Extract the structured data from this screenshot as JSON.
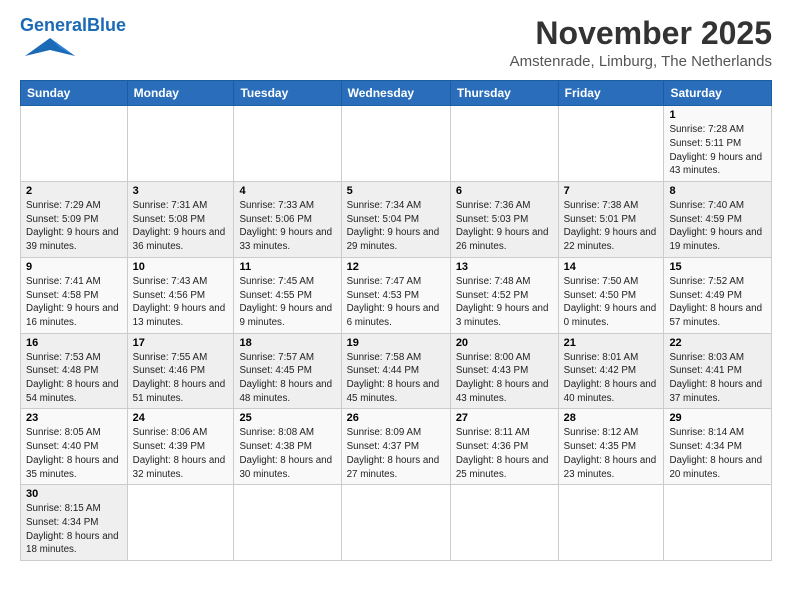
{
  "header": {
    "logo_general": "General",
    "logo_blue": "Blue",
    "title": "November 2025",
    "subtitle": "Amstenrade, Limburg, The Netherlands"
  },
  "days_of_week": [
    "Sunday",
    "Monday",
    "Tuesday",
    "Wednesday",
    "Thursday",
    "Friday",
    "Saturday"
  ],
  "weeks": [
    [
      {
        "day": "",
        "info": ""
      },
      {
        "day": "",
        "info": ""
      },
      {
        "day": "",
        "info": ""
      },
      {
        "day": "",
        "info": ""
      },
      {
        "day": "",
        "info": ""
      },
      {
        "day": "",
        "info": ""
      },
      {
        "day": "1",
        "info": "Sunrise: 7:28 AM\nSunset: 5:11 PM\nDaylight: 9 hours and 43 minutes."
      }
    ],
    [
      {
        "day": "2",
        "info": "Sunrise: 7:29 AM\nSunset: 5:09 PM\nDaylight: 9 hours and 39 minutes."
      },
      {
        "day": "3",
        "info": "Sunrise: 7:31 AM\nSunset: 5:08 PM\nDaylight: 9 hours and 36 minutes."
      },
      {
        "day": "4",
        "info": "Sunrise: 7:33 AM\nSunset: 5:06 PM\nDaylight: 9 hours and 33 minutes."
      },
      {
        "day": "5",
        "info": "Sunrise: 7:34 AM\nSunset: 5:04 PM\nDaylight: 9 hours and 29 minutes."
      },
      {
        "day": "6",
        "info": "Sunrise: 7:36 AM\nSunset: 5:03 PM\nDaylight: 9 hours and 26 minutes."
      },
      {
        "day": "7",
        "info": "Sunrise: 7:38 AM\nSunset: 5:01 PM\nDaylight: 9 hours and 22 minutes."
      },
      {
        "day": "8",
        "info": "Sunrise: 7:40 AM\nSunset: 4:59 PM\nDaylight: 9 hours and 19 minutes."
      }
    ],
    [
      {
        "day": "9",
        "info": "Sunrise: 7:41 AM\nSunset: 4:58 PM\nDaylight: 9 hours and 16 minutes."
      },
      {
        "day": "10",
        "info": "Sunrise: 7:43 AM\nSunset: 4:56 PM\nDaylight: 9 hours and 13 minutes."
      },
      {
        "day": "11",
        "info": "Sunrise: 7:45 AM\nSunset: 4:55 PM\nDaylight: 9 hours and 9 minutes."
      },
      {
        "day": "12",
        "info": "Sunrise: 7:47 AM\nSunset: 4:53 PM\nDaylight: 9 hours and 6 minutes."
      },
      {
        "day": "13",
        "info": "Sunrise: 7:48 AM\nSunset: 4:52 PM\nDaylight: 9 hours and 3 minutes."
      },
      {
        "day": "14",
        "info": "Sunrise: 7:50 AM\nSunset: 4:50 PM\nDaylight: 9 hours and 0 minutes."
      },
      {
        "day": "15",
        "info": "Sunrise: 7:52 AM\nSunset: 4:49 PM\nDaylight: 8 hours and 57 minutes."
      }
    ],
    [
      {
        "day": "16",
        "info": "Sunrise: 7:53 AM\nSunset: 4:48 PM\nDaylight: 8 hours and 54 minutes."
      },
      {
        "day": "17",
        "info": "Sunrise: 7:55 AM\nSunset: 4:46 PM\nDaylight: 8 hours and 51 minutes."
      },
      {
        "day": "18",
        "info": "Sunrise: 7:57 AM\nSunset: 4:45 PM\nDaylight: 8 hours and 48 minutes."
      },
      {
        "day": "19",
        "info": "Sunrise: 7:58 AM\nSunset: 4:44 PM\nDaylight: 8 hours and 45 minutes."
      },
      {
        "day": "20",
        "info": "Sunrise: 8:00 AM\nSunset: 4:43 PM\nDaylight: 8 hours and 43 minutes."
      },
      {
        "day": "21",
        "info": "Sunrise: 8:01 AM\nSunset: 4:42 PM\nDaylight: 8 hours and 40 minutes."
      },
      {
        "day": "22",
        "info": "Sunrise: 8:03 AM\nSunset: 4:41 PM\nDaylight: 8 hours and 37 minutes."
      }
    ],
    [
      {
        "day": "23",
        "info": "Sunrise: 8:05 AM\nSunset: 4:40 PM\nDaylight: 8 hours and 35 minutes."
      },
      {
        "day": "24",
        "info": "Sunrise: 8:06 AM\nSunset: 4:39 PM\nDaylight: 8 hours and 32 minutes."
      },
      {
        "day": "25",
        "info": "Sunrise: 8:08 AM\nSunset: 4:38 PM\nDaylight: 8 hours and 30 minutes."
      },
      {
        "day": "26",
        "info": "Sunrise: 8:09 AM\nSunset: 4:37 PM\nDaylight: 8 hours and 27 minutes."
      },
      {
        "day": "27",
        "info": "Sunrise: 8:11 AM\nSunset: 4:36 PM\nDaylight: 8 hours and 25 minutes."
      },
      {
        "day": "28",
        "info": "Sunrise: 8:12 AM\nSunset: 4:35 PM\nDaylight: 8 hours and 23 minutes."
      },
      {
        "day": "29",
        "info": "Sunrise: 8:14 AM\nSunset: 4:34 PM\nDaylight: 8 hours and 20 minutes."
      }
    ],
    [
      {
        "day": "30",
        "info": "Sunrise: 8:15 AM\nSunset: 4:34 PM\nDaylight: 8 hours and 18 minutes."
      },
      {
        "day": "",
        "info": ""
      },
      {
        "day": "",
        "info": ""
      },
      {
        "day": "",
        "info": ""
      },
      {
        "day": "",
        "info": ""
      },
      {
        "day": "",
        "info": ""
      },
      {
        "day": "",
        "info": ""
      }
    ]
  ]
}
